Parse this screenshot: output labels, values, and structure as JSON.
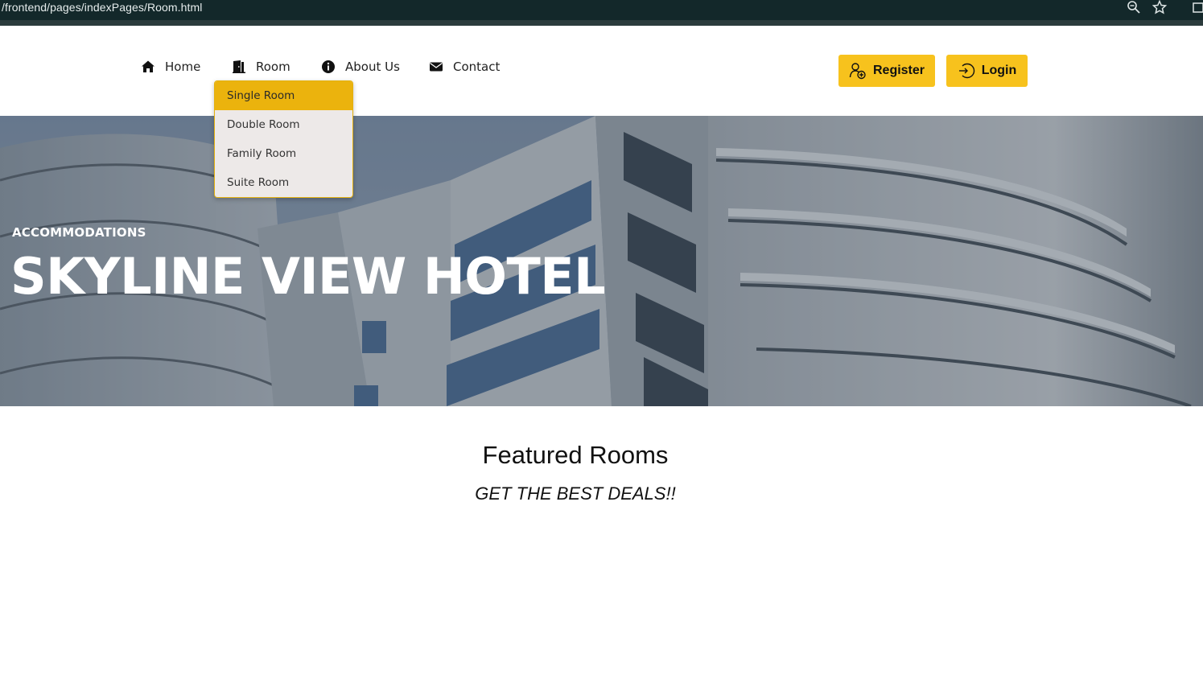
{
  "browser": {
    "url": "/frontend/pages/indexPages/Room.html",
    "icons": [
      "zoom-icon",
      "star-icon",
      "extension-icon"
    ]
  },
  "nav": {
    "items": [
      {
        "label": "Home",
        "icon": "home-icon"
      },
      {
        "label": "Room",
        "icon": "door-icon"
      },
      {
        "label": "About Us",
        "icon": "info-icon"
      },
      {
        "label": "Contact",
        "icon": "envelope-icon"
      }
    ],
    "register_label": "Register",
    "login_label": "Login"
  },
  "room_dropdown": {
    "items": [
      "Single Room",
      "Double Room",
      "Family Room",
      "Suite Room"
    ],
    "selected": "Single Room"
  },
  "hero": {
    "kicker": "ACCOMMODATIONS",
    "title": "SKYLINE VIEW HOTEL"
  },
  "section": {
    "title": "Featured Rooms",
    "subtitle": "GET THE BEST DEALS!!"
  },
  "colors": {
    "accent": "#f7c21d",
    "dropdown_active": "#ebb30d",
    "chrome_bg": "#13282a"
  }
}
